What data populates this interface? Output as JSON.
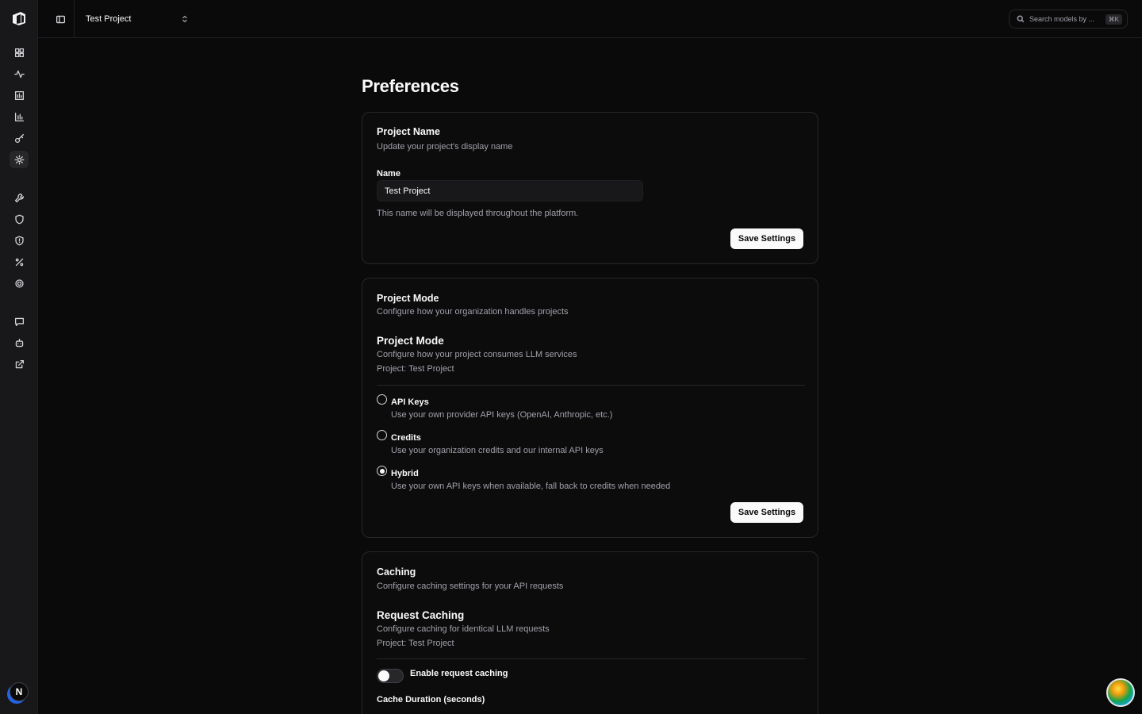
{
  "topbar": {
    "project_selector": "Test Project",
    "search_placeholder": "Search models by ...",
    "search_shortcut": "⌘K"
  },
  "sidebar": {
    "icons": [
      "dashboard-icon",
      "activity-icon",
      "bar-chart-icon",
      "chart-icon",
      "key-icon",
      "settings-icon",
      "wrench-icon",
      "shield-icon",
      "shield-alert-icon",
      "percent-icon",
      "gear-icon",
      "message-icon",
      "bot-icon",
      "external-link-icon"
    ],
    "active": "settings-icon",
    "avatar_initial": "N"
  },
  "page": {
    "title": "Preferences"
  },
  "project_name_card": {
    "title": "Project Name",
    "description": "Update your project's display name",
    "field_label": "Name",
    "field_value": "Test Project",
    "helper": "This name will be displayed throughout the platform.",
    "save_label": "Save Settings"
  },
  "project_mode_card": {
    "title": "Project Mode",
    "description": "Configure how your organization handles projects",
    "section_title": "Project Mode",
    "section_description": "Configure how your project consumes LLM services",
    "project_line": "Project: Test Project",
    "options": [
      {
        "label": "API Keys",
        "description": "Use your own provider API keys (OpenAI, Anthropic, etc.)",
        "selected": false
      },
      {
        "label": "Credits",
        "description": "Use your organization credits and our internal API keys",
        "selected": false
      },
      {
        "label": "Hybrid",
        "description": "Use your own API keys when available, fall back to credits when needed",
        "selected": true
      }
    ],
    "save_label": "Save Settings"
  },
  "caching_card": {
    "title": "Caching",
    "description": "Configure caching settings for your API requests",
    "section_title": "Request Caching",
    "section_description": "Configure caching for identical LLM requests",
    "project_line": "Project: Test Project",
    "toggle_label": "Enable request caching",
    "toggle_on": false,
    "duration_label": "Cache Duration (seconds)"
  },
  "colors": {
    "background": "#0a0a0b",
    "sidebar": "#18181b",
    "card_border": "#27272a",
    "primary_button": "#fafafa",
    "muted_text": "#a1a1aa"
  }
}
